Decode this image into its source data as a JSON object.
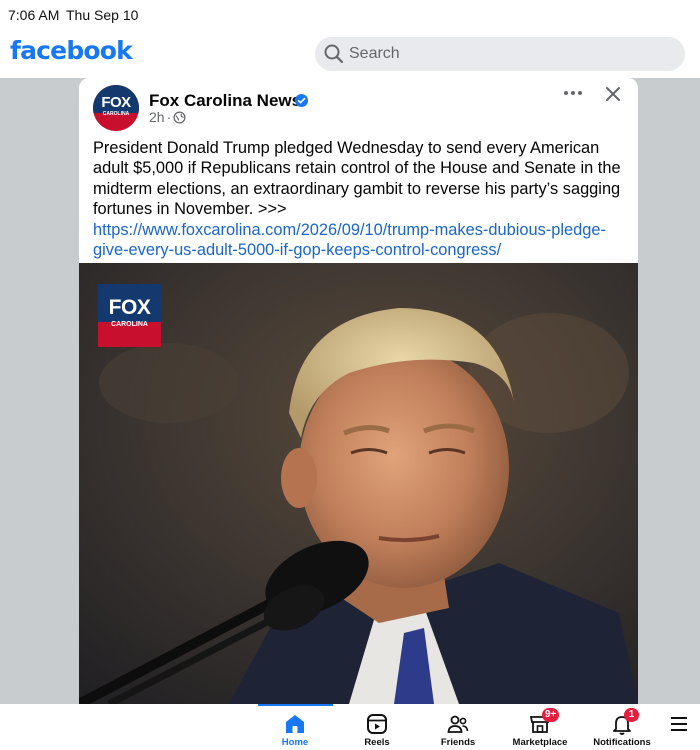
{
  "status_bar": {
    "time": "7:06 AM",
    "date": "Thu Sep 10"
  },
  "header": {
    "logo": "facebook",
    "search_placeholder": "Search"
  },
  "post": {
    "page_name": "Fox Carolina News",
    "avatar_text": "FOX",
    "avatar_subtext": "CAROLINA",
    "time": "2h",
    "body": "President Donald Trump pledged Wednesday to send every American adult $5,000 if Republicans retain control of the House and Senate in the midterm elections, an extraordinary gambit to reverse his party’s sagging fortunes in November. >>> ",
    "link": "https://www.foxcarolina.com/2026/09/10/trump-makes-dubious-pledge-give-every-us-adult-5000-if-gop-keeps-control-congress/",
    "photo_logo_text": "FOX",
    "photo_logo_subtext": "CAROLINA"
  },
  "bottom_nav": {
    "home": "Home",
    "reels": "Reels",
    "friends": "Friends",
    "marketplace": "Marketplace",
    "marketplace_badge": "9+",
    "notifications": "Notifications",
    "notifications_badge": "1"
  },
  "colors": {
    "brand": "#1877f2",
    "link": "#1b66c9",
    "badge": "#e41e3f"
  }
}
